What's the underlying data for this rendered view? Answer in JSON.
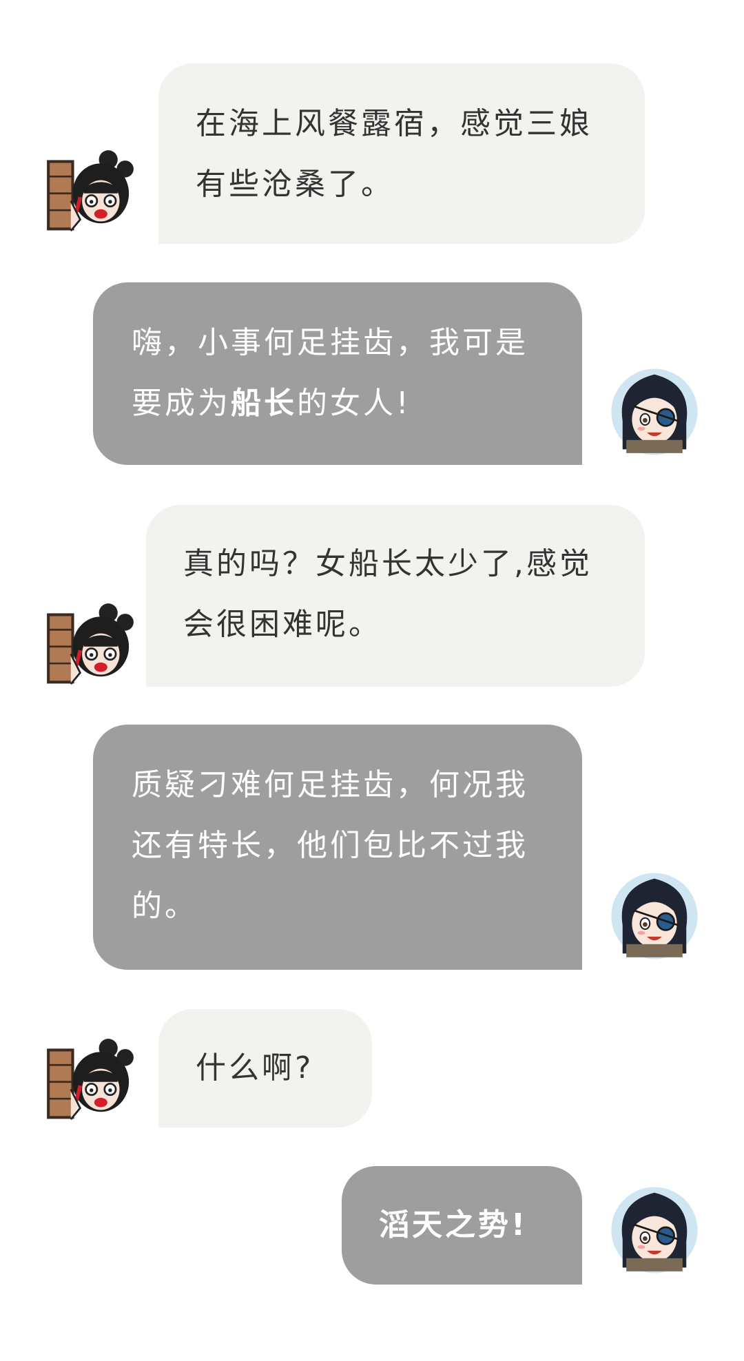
{
  "messages": [
    {
      "side": "left",
      "lines": [
        "在海上风餐露宿，感觉三娘",
        "有些沧桑了。"
      ]
    },
    {
      "side": "right",
      "line1": "嗨，小事何足挂齿，我可是",
      "line2_pre": "要成为",
      "line2_bold": "船长",
      "line2_post": "的女人!"
    },
    {
      "side": "left",
      "lines": [
        "真的吗？女船长太少了,感觉",
        "会很困难呢。"
      ]
    },
    {
      "side": "right",
      "lines": [
        "质疑刁难何足挂齿，何况我",
        "还有特长，他们包比不过我",
        "的。"
      ]
    },
    {
      "side": "left",
      "lines": [
        "什么啊?"
      ]
    },
    {
      "side": "right",
      "lines": [
        "滔天之势!"
      ]
    }
  ],
  "avatars": {
    "left": "shocked-chibi-peeking-from-wall-icon",
    "right": "pirate-girl-eyepatch-chibi-icon"
  },
  "colors": {
    "light_bubble": "#f2f2ef",
    "dark_bubble": "#9e9e9e",
    "light_text": "#333333",
    "dark_text": "#ffffff"
  }
}
